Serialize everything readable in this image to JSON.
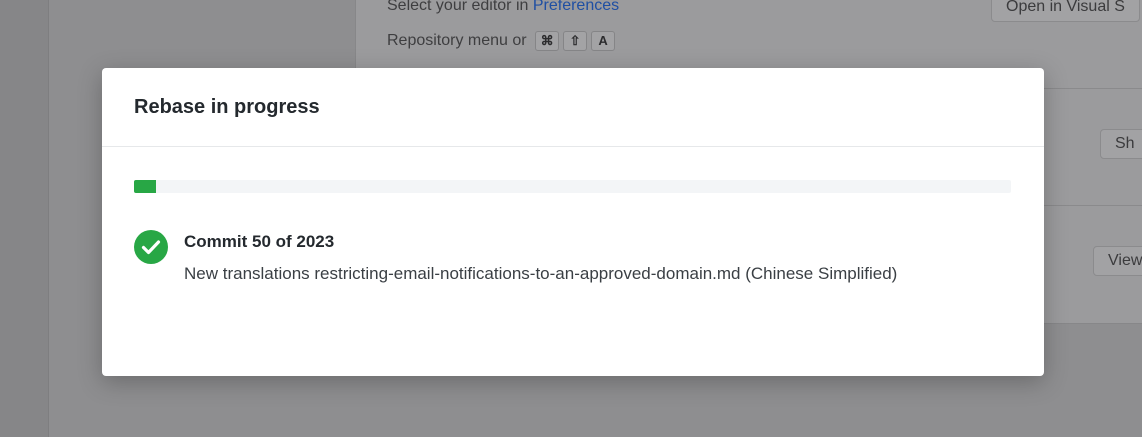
{
  "background": {
    "editor_hint_prefix": "Select your editor in",
    "editor_hint_link": "Preferences",
    "repository_menu_text": "Repository menu or",
    "shortcut_keys": [
      "⌘",
      "⇧",
      "A"
    ],
    "open_button_label": "Open in Visual S",
    "show_button_label": "Sh",
    "view_button_label": "View"
  },
  "modal": {
    "title": "Rebase in progress",
    "progress": {
      "current": 50,
      "total": 2023,
      "fraction": 0.0247,
      "color": "#28a745"
    },
    "commit": {
      "status_icon": "check-circle-icon",
      "status_color": "#28a745",
      "title": "Commit 50 of 2023",
      "summary": "New translations restricting-email-notifications-to-an-approved-domain.md (Chinese Simplified)"
    }
  }
}
